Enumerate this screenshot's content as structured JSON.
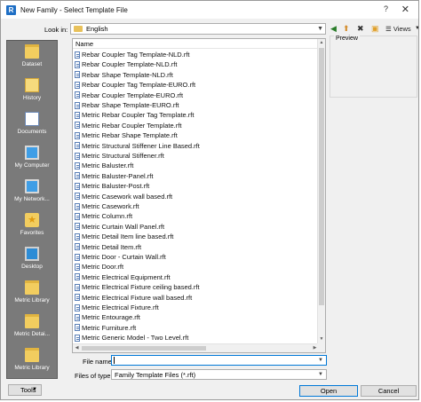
{
  "window": {
    "title": "New Family - Select Template File",
    "app_icon": "R",
    "help": "?",
    "close": "✕"
  },
  "toolbar": {
    "lookin_label": "Look in:",
    "lookin_value": "English",
    "views_label": "Views",
    "icons": [
      "back-icon",
      "up-folder-icon",
      "delete-icon",
      "new-folder-icon",
      "views-icon"
    ]
  },
  "places": [
    {
      "label": "Dataset",
      "icon": "folder-icon"
    },
    {
      "label": "History",
      "icon": "history-icon"
    },
    {
      "label": "Documents",
      "icon": "documents-icon"
    },
    {
      "label": "My Computer",
      "icon": "computer-icon"
    },
    {
      "label": "My Network...",
      "icon": "network-icon"
    },
    {
      "label": "Favorites",
      "icon": "favorites-icon"
    },
    {
      "label": "Desktop",
      "icon": "desktop-icon"
    },
    {
      "label": "Metric Library",
      "icon": "folder-icon"
    },
    {
      "label": "Metric Detai...",
      "icon": "folder-icon"
    },
    {
      "label": "Metric Library",
      "icon": "folder-icon"
    }
  ],
  "file_list": {
    "column_header": "Name",
    "files": [
      "Rebar Coupler Tag Template-NLD.rft",
      "Rebar Coupler Template-NLD.rft",
      "Rebar Shape Template-NLD.rft",
      "Rebar Coupler Tag Template-EURO.rft",
      "Rebar Coupler Template-EURO.rft",
      "Rebar Shape Template-EURO.rft",
      "Metric Rebar Coupler Tag Template.rft",
      "Metric Rebar Coupler Template.rft",
      "Metric Rebar Shape Template.rft",
      "Metric Structural Stiffener Line Based.rft",
      "Metric Structural Stiffener.rft",
      "Metric Baluster.rft",
      "Metric Baluster-Panel.rft",
      "Metric Baluster-Post.rft",
      "Metric Casework wall based.rft",
      "Metric Casework.rft",
      "Metric Column.rft",
      "Metric Curtain Wall Panel.rft",
      "Metric Detail Item line based.rft",
      "Metric Detail Item.rft",
      "Metric Door - Curtain Wall.rft",
      "Metric Door.rft",
      "Metric Electrical Equipment.rft",
      "Metric Electrical Fixture ceiling based.rft",
      "Metric Electrical Fixture wall based.rft",
      "Metric Electrical Fixture.rft",
      "Metric Entourage.rft",
      "Metric Furniture.rft",
      "Metric Generic Model - Two Level.rft"
    ]
  },
  "preview": {
    "label": "Preview"
  },
  "form": {
    "filename_label": "File name:",
    "filename_value": "",
    "filetype_label": "Files of type:",
    "filetype_value": "Family Template Files  (*.rft)"
  },
  "buttons": {
    "tools": "Tools",
    "open": "Open",
    "cancel": "Cancel"
  }
}
